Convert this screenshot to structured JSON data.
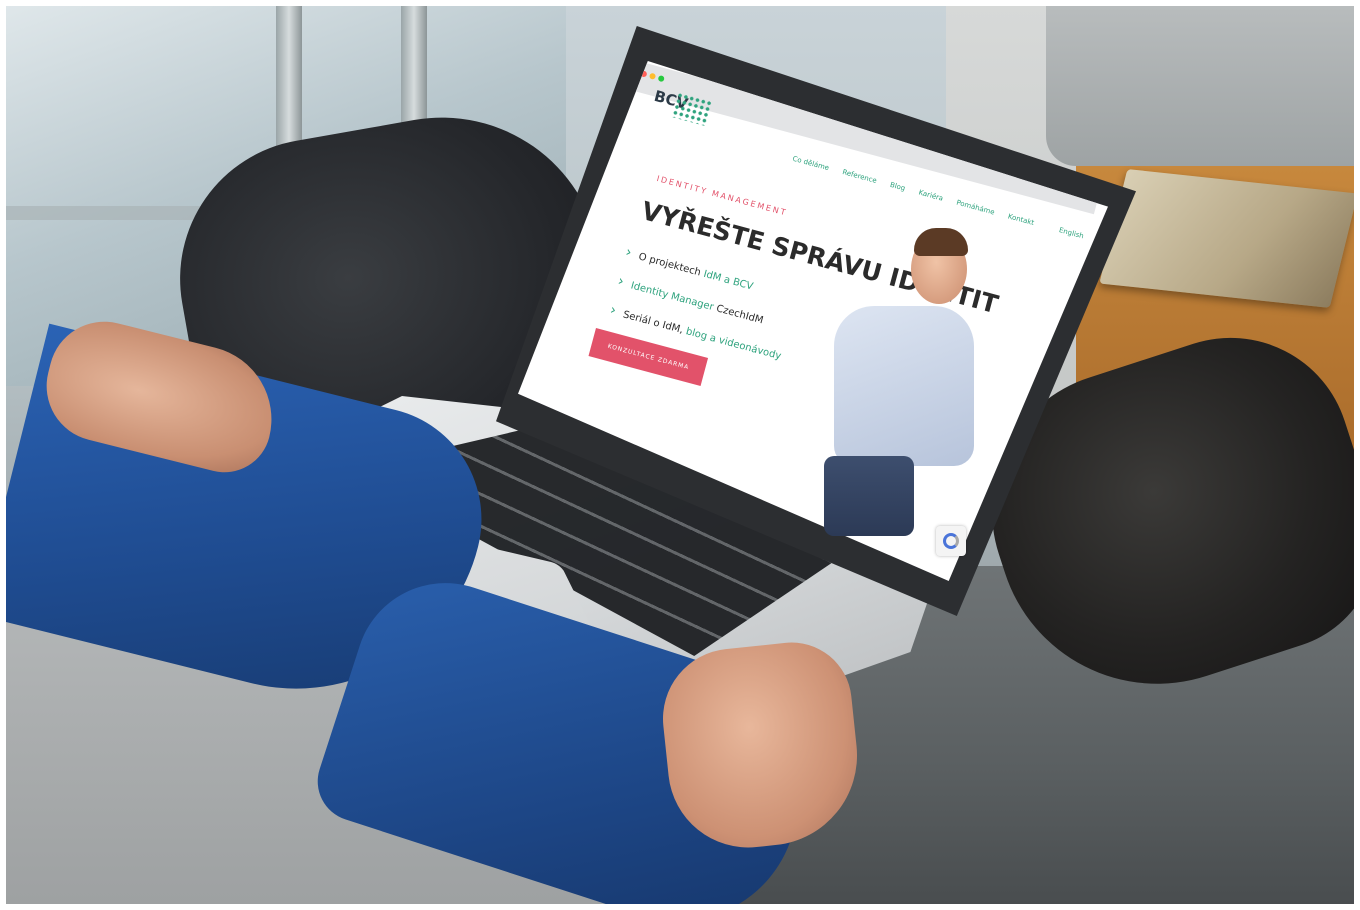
{
  "screen": {
    "logo": "BCV",
    "nav": [
      "Co děláme",
      "Reference",
      "Blog",
      "Kariéra",
      "Pomáháme",
      "Kontakt"
    ],
    "language": "English",
    "eyebrow": "IDENTITY MANAGEMENT",
    "headline": "VYŘEŠTE SPRÁVU IDENTIT",
    "bullets": [
      {
        "text": "O projektech ",
        "accent": "IdM a BCV"
      },
      {
        "text": "",
        "accent": "Identity Manager",
        "tail": " CzechIdM"
      },
      {
        "text": "Seriál o IdM, ",
        "accent": "blog",
        "tail": " a videonávody"
      }
    ],
    "cta": "KONZULTACE ZDARMA"
  },
  "colors": {
    "accent_green": "#2fa37e",
    "accent_red": "#e2526a",
    "shirt_blue": "#1f4c91"
  }
}
